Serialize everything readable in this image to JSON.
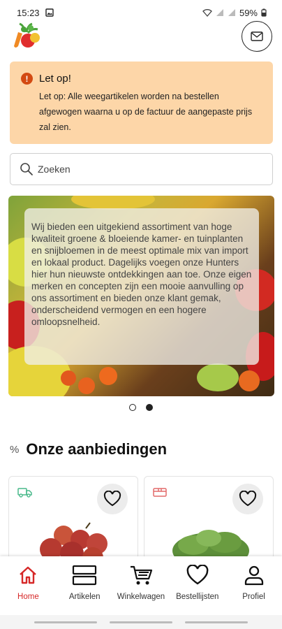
{
  "status_bar": {
    "time": "15:23",
    "battery": "59%"
  },
  "alert": {
    "title": "Let op!",
    "text": "Let op: Alle weegartikelen worden na bestellen afgewogen waarna u op de factuur de aangepaste prijs zal zien."
  },
  "search": {
    "placeholder": "Zoeken"
  },
  "carousel": {
    "text": "Wij bieden een uitgekiend assortiment van hoge kwaliteit groene & bloeiende kamer- en tuinplanten en snijbloemen in de meest optimale mix van import en lokaal product. Dagelijks voegen onze Hunters hier hun nieuwste ontdekkingen aan toe. Onze eigen merken en concepten zijn een mooie aanvulling op ons assortiment en bieden onze klant gemak, onderscheidend vermogen en een hogere omloopsnelheid."
  },
  "section": {
    "title": "Onze aanbiedingen"
  },
  "nav": {
    "home": "Home",
    "articles": "Artikelen",
    "cart": "Winkelwagen",
    "orderlists": "Bestellijsten",
    "profile": "Profiel"
  },
  "colors": {
    "accent": "#d62828",
    "alert_bg": "#fdd6a8",
    "alert_icon": "#d34a12"
  }
}
